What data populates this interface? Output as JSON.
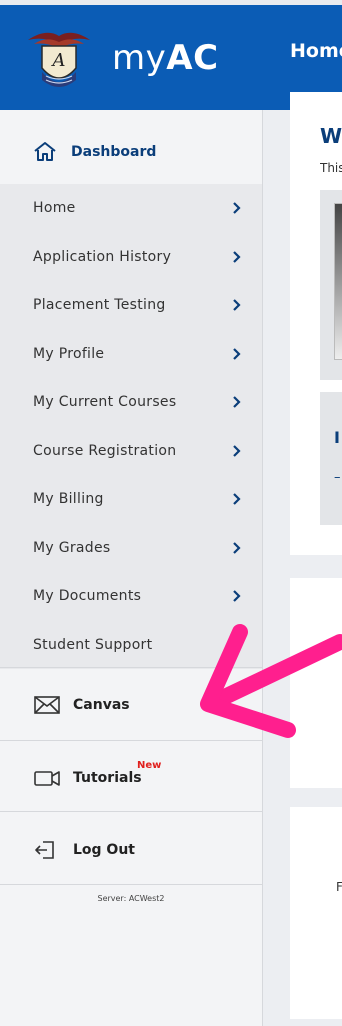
{
  "header": {
    "logo_text_plain": "my",
    "logo_text_bold": "AC",
    "page_title": "Home"
  },
  "sidebar": {
    "dashboard_label": "Dashboard",
    "items": [
      {
        "label": "Home",
        "has_chevron": true
      },
      {
        "label": "Application History",
        "has_chevron": true
      },
      {
        "label": "Placement Testing",
        "has_chevron": true
      },
      {
        "label": "My Profile",
        "has_chevron": true
      },
      {
        "label": "My Current Courses",
        "has_chevron": true
      },
      {
        "label": "Course Registration",
        "has_chevron": true
      },
      {
        "label": "My Billing",
        "has_chevron": true
      },
      {
        "label": "My Grades",
        "has_chevron": true
      },
      {
        "label": "My Documents",
        "has_chevron": true
      },
      {
        "label": "Student Support",
        "has_chevron": false
      }
    ],
    "canvas_label": "Canvas",
    "tutorials_label": "Tutorials",
    "tutorials_badge": "New",
    "logout_label": "Log Out",
    "server_text": "Server: ACWest2"
  },
  "main": {
    "welcome_heading": "W",
    "welcome_sub": "This",
    "info_heading": "I",
    "info_dash": "–",
    "footer_letter": "F"
  },
  "colors": {
    "brand_blue": "#0b5cb5",
    "navy_text": "#0b3e7a",
    "annotation_arrow": "#ff1f8e",
    "badge_red": "#e0201e"
  },
  "icons": [
    "house-icon",
    "chevron-right-icon",
    "envelope-icon",
    "video-camera-icon",
    "logout-arrow-icon",
    "college-emblem-logo"
  ]
}
